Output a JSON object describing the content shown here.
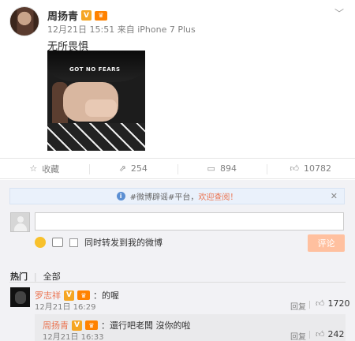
{
  "post": {
    "author": "周扬青",
    "time": "12月21日 15:51",
    "source_label": "来自",
    "source": "iPhone 7 Plus",
    "text": "无所畏惧",
    "image_caption": "GOT NO FEARS"
  },
  "actions": {
    "favorite": "收藏",
    "repost": "254",
    "comments": "894",
    "likes": "10782"
  },
  "comment_box": {
    "notice_prefix": "#微博辟谣#平台，",
    "notice_link": "欢迎查阅！",
    "also_repost": "同时转发到我的微博",
    "submit": "评论"
  },
  "tabs": {
    "hot": "热门",
    "all": "全部"
  },
  "comments": [
    {
      "author": "罗志祥",
      "text": "：的喔",
      "time": "12月21日 16:29",
      "reply": "回复",
      "likes": "1720"
    }
  ],
  "sub_comment": {
    "author": "周扬青",
    "text": "：還行吧老闆 沒你的啦",
    "time": "12月21日 16:33",
    "reply": "回复",
    "likes": "242"
  },
  "colors": {
    "accent": "#eb7350",
    "badge_v": "#f5a623",
    "submit_disabled": "#ffc09f"
  }
}
